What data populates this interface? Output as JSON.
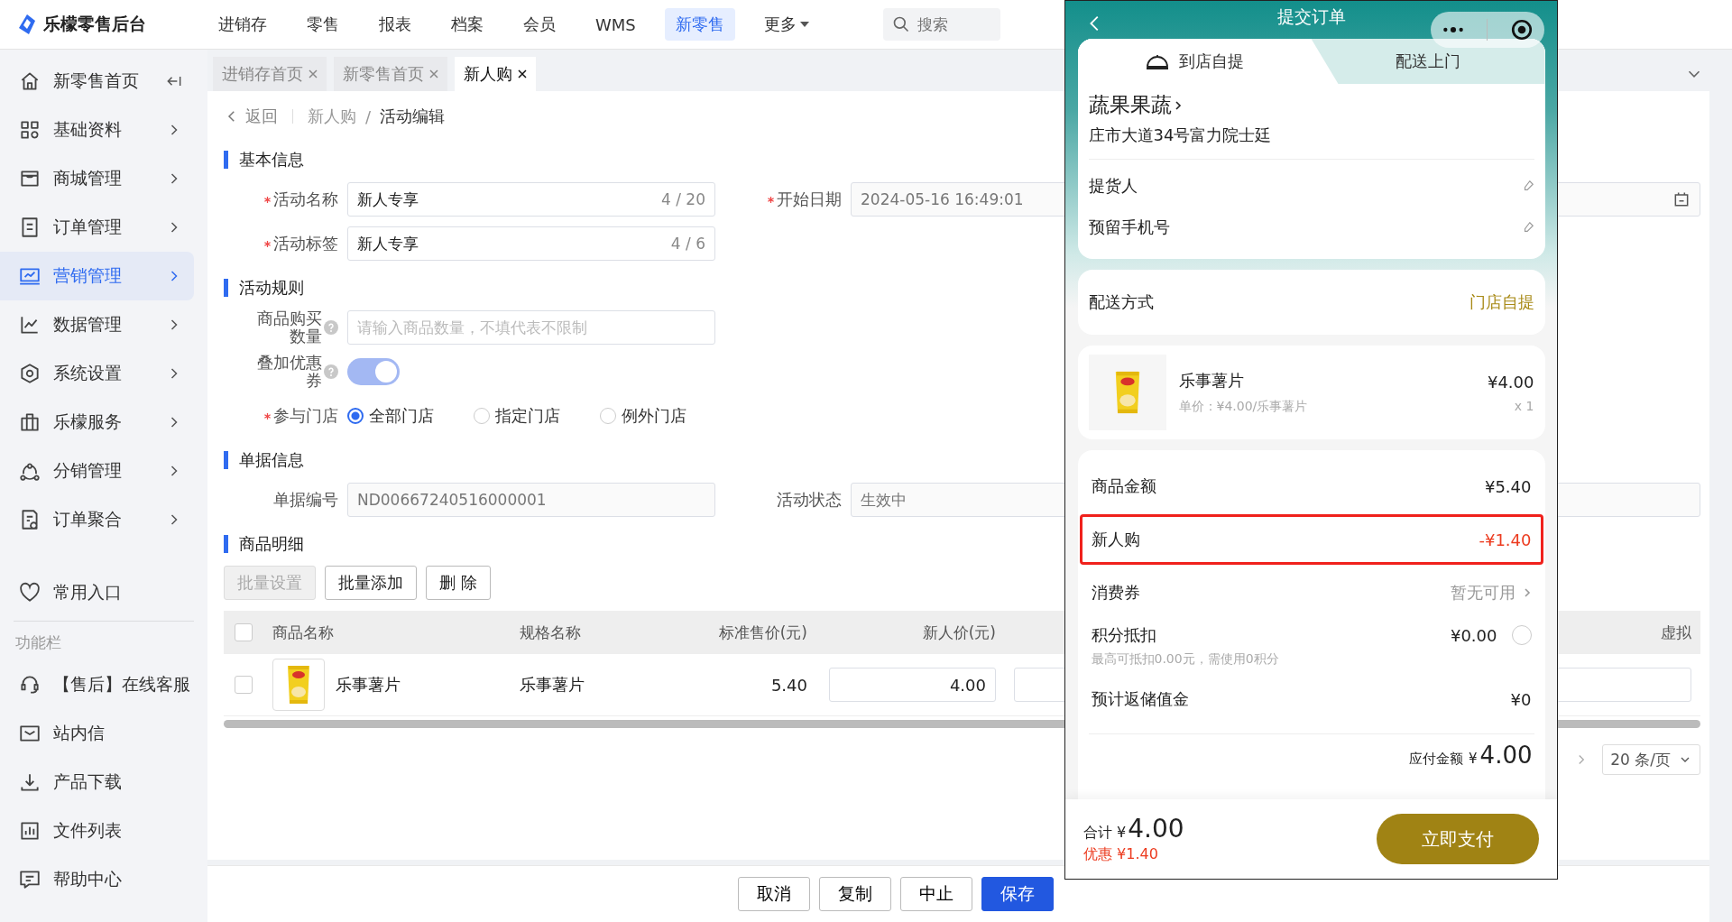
{
  "app": {
    "logo_text": "乐檬零售后台"
  },
  "top_nav": [
    {
      "label": "进销存",
      "selected": false,
      "has_menu": false
    },
    {
      "label": "零售",
      "selected": false,
      "has_menu": false
    },
    {
      "label": "报表",
      "selected": false,
      "has_menu": false
    },
    {
      "label": "档案",
      "selected": false,
      "has_menu": false
    },
    {
      "label": "会员",
      "selected": false,
      "has_menu": false
    },
    {
      "label": "WMS",
      "selected": false,
      "has_menu": false
    },
    {
      "label": "新零售",
      "selected": true,
      "has_menu": false
    },
    {
      "label": "更多",
      "selected": false,
      "has_menu": true
    }
  ],
  "search": {
    "placeholder": "搜索"
  },
  "sidebar": {
    "items": [
      {
        "label": "新零售首页",
        "kind": "home",
        "selected": false
      },
      {
        "label": "基础资料",
        "kind": "group",
        "selected": false
      },
      {
        "label": "商城管理",
        "kind": "group",
        "selected": false
      },
      {
        "label": "订单管理",
        "kind": "group",
        "selected": false
      },
      {
        "label": "营销管理",
        "kind": "group",
        "selected": true
      },
      {
        "label": "数据管理",
        "kind": "group",
        "selected": false
      },
      {
        "label": "系统设置",
        "kind": "group",
        "selected": false
      },
      {
        "label": "乐檬服务",
        "kind": "group",
        "selected": false
      },
      {
        "label": "分销管理",
        "kind": "group",
        "selected": false
      },
      {
        "label": "订单聚合",
        "kind": "group",
        "selected": false
      }
    ],
    "favorites": "常用入口",
    "section_title": "功能栏",
    "tools": [
      "【售后】在线客服",
      "站内信",
      "产品下载",
      "文件列表",
      "帮助中心"
    ]
  },
  "page_tabs": [
    {
      "label": "进销存首页",
      "selected": false
    },
    {
      "label": "新零售首页",
      "selected": false
    },
    {
      "label": "新人购",
      "selected": true
    }
  ],
  "breadcrumb": {
    "back": "返回",
    "path": [
      "新人购",
      "活动编辑"
    ],
    "separator": "/"
  },
  "form": {
    "basic": {
      "title": "基本信息",
      "name": {
        "label": "活动名称",
        "required": true,
        "value": "新人专享",
        "counter": "4 / 20"
      },
      "tag": {
        "label": "活动标签",
        "required": true,
        "value": "新人专享",
        "counter": "4 / 6"
      },
      "start_date": {
        "label": "开始日期",
        "required": true,
        "value": "2024-05-16 16:49:01"
      }
    },
    "rules": {
      "title": "活动规则",
      "quantity": {
        "label": "商品购买数量",
        "help": true,
        "placeholder": "请输入商品数量，不填代表不限制"
      },
      "stack_coupon": {
        "label": "叠加优惠券",
        "help": true,
        "on": true
      },
      "stores": {
        "label": "参与门店",
        "required": true,
        "options": [
          {
            "label": "全部门店",
            "selected": true
          },
          {
            "label": "指定门店",
            "selected": false
          },
          {
            "label": "例外门店",
            "selected": false
          }
        ]
      }
    },
    "document": {
      "title": "单据信息",
      "number": {
        "label": "单据编号",
        "value": "ND00667240516000001"
      },
      "status": {
        "label": "活动状态",
        "value": "生效中"
      }
    },
    "goods": {
      "title": "商品明细",
      "buttons": [
        {
          "label": "批量设置",
          "disabled": true
        },
        {
          "label": "批量添加",
          "disabled": false
        },
        {
          "label": "删 除",
          "disabled": false
        }
      ],
      "table": {
        "all_checked": false,
        "columns": [
          "商品名称",
          "规格名称",
          "标准售价(元)",
          "新人价(元)",
          "虚拟"
        ],
        "rows": [
          {
            "checked": false,
            "name": "乐事薯片",
            "spec": "乐事薯片",
            "price": "5.40",
            "new_price": "4.00"
          }
        ]
      }
    }
  },
  "pagination": {
    "page_size": "20 条/页"
  },
  "actions": [
    {
      "label": "取消",
      "kind": "default"
    },
    {
      "label": "复制",
      "kind": "default"
    },
    {
      "label": "中止",
      "kind": "default"
    },
    {
      "label": "保存",
      "kind": "primary"
    }
  ],
  "phone": {
    "title": "提交订单",
    "tabs": [
      {
        "label": "到店自提",
        "selected": true
      },
      {
        "label": "配送上门",
        "selected": false
      }
    ],
    "store": {
      "name": "蔬果果蔬",
      "address": "庄市大道34号富力院士廷"
    },
    "contact_fields": [
      "提货人",
      "预留手机号"
    ],
    "delivery": {
      "label": "配送方式",
      "value": "门店自提"
    },
    "product": {
      "name": "乐事薯片",
      "unit_price": "单价：¥4.00/乐事薯片",
      "price": "¥4.00",
      "quantity": "x 1"
    },
    "summary": [
      {
        "label": "商品金额",
        "value": "¥5.40",
        "kind": "plain",
        "highlighted": false
      },
      {
        "label": "新人购",
        "value": "-¥1.40",
        "kind": "discount",
        "highlighted": true
      },
      {
        "label": "消费券",
        "value": "暂无可用",
        "kind": "link",
        "highlighted": false
      },
      {
        "label": "积分抵扣",
        "value": "¥0.00",
        "kind": "points",
        "note": "最高可抵扣0.00元，需使用0积分",
        "checked": false,
        "highlighted": false
      },
      {
        "label": "预计返储值金",
        "value": "¥0",
        "kind": "plain",
        "highlighted": false
      }
    ],
    "payable": {
      "label": "应付金额",
      "currency": "¥",
      "amount": "4.00"
    },
    "footer": {
      "total_label": "合计",
      "currency": "¥",
      "total": "4.00",
      "discount": "优惠 ¥1.40",
      "pay_button": "立即支付"
    }
  }
}
